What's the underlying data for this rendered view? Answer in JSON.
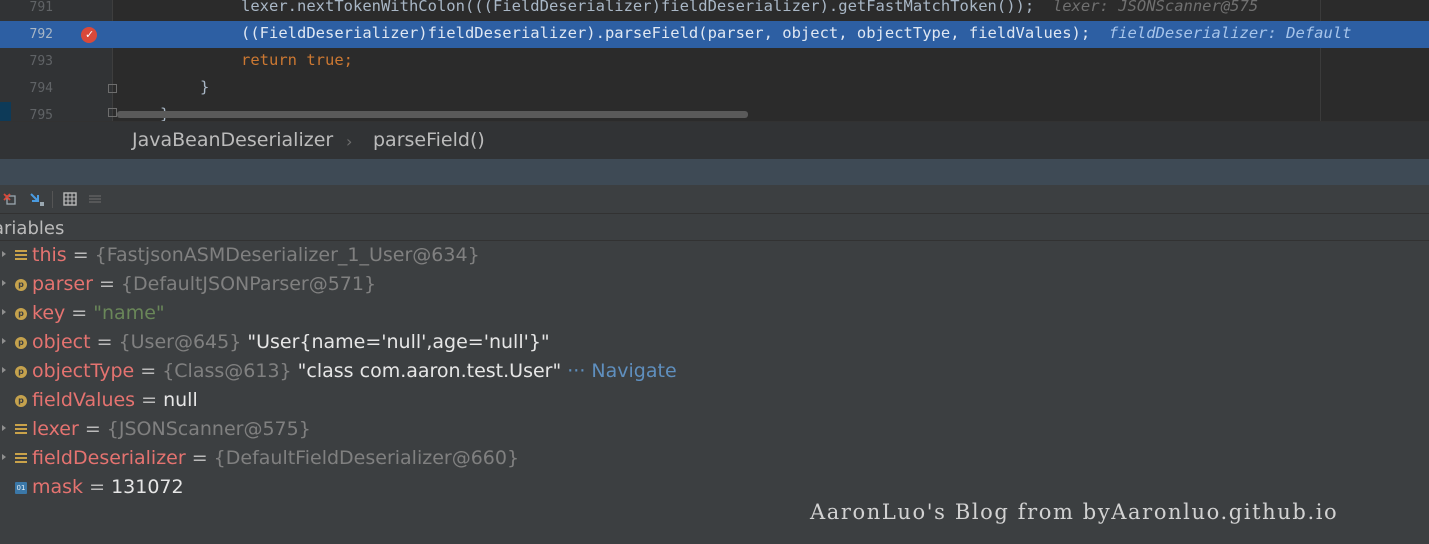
{
  "editor": {
    "lines": [
      {
        "num": "791",
        "code": "lexer.nextTokenWithColon(((FieldDeserializer)fieldDeserializer).getFastMatchToken());",
        "hint": "lexer: JSONScanner@575"
      },
      {
        "num": "792",
        "code": "((FieldDeserializer)fieldDeserializer).parseField(parser, object, objectType, fieldValues);",
        "hint": "fieldDeserializer: Default"
      },
      {
        "num": "793",
        "kw": "return true",
        "semi": ";"
      },
      {
        "num": "794",
        "code": "}"
      },
      {
        "num": "795",
        "code": "}"
      }
    ]
  },
  "breadcrumb": {
    "class_name": "JavaBeanDeserializer",
    "separator": "›",
    "method": "parseField()"
  },
  "variables": {
    "title": "ariables",
    "items": [
      {
        "icon": "field-icon",
        "name": "this",
        "eq": " = ",
        "ref": "{FastjsonASMDeserializer_1_User@634}"
      },
      {
        "icon": "parameter-icon",
        "name": "parser",
        "eq": " = ",
        "ref": "{DefaultJSONParser@571}"
      },
      {
        "icon": "parameter-icon",
        "name": "key",
        "eq": " = ",
        "str": "\"name\""
      },
      {
        "icon": "parameter-icon",
        "name": "object",
        "eq": " = ",
        "ref": "{User@645}",
        "val": " \"User{name='null',age='null'}\""
      },
      {
        "icon": "parameter-icon",
        "name": "objectType",
        "eq": " = ",
        "ref": "{Class@613}",
        "val": " \"class com.aaron.test.User\"",
        "more": " ··· ",
        "nav": "Navigate"
      },
      {
        "icon": "parameter-icon",
        "name": "fieldValues",
        "eq": " = ",
        "val": "null"
      },
      {
        "icon": "field-icon",
        "name": "lexer",
        "eq": " = ",
        "ref": "{JSONScanner@575}"
      },
      {
        "icon": "field-icon",
        "name": "fieldDeserializer",
        "eq": " = ",
        "ref": "{DefaultFieldDeserializer@660}"
      },
      {
        "icon": "primitive-icon",
        "name": "mask",
        "eq": " = ",
        "val": "131072"
      }
    ]
  },
  "watermark": "AaronLuo's Blog from byAaronluo.github.io",
  "colors": {
    "background": "#2b2b2b",
    "selected_line": "#2d5fa3",
    "variable_name": "#e57370",
    "string_value": "#6a8759",
    "keyword": "#cc7832",
    "breakpoint": "#d9493a",
    "navigate_link": "#5f8fbe"
  }
}
